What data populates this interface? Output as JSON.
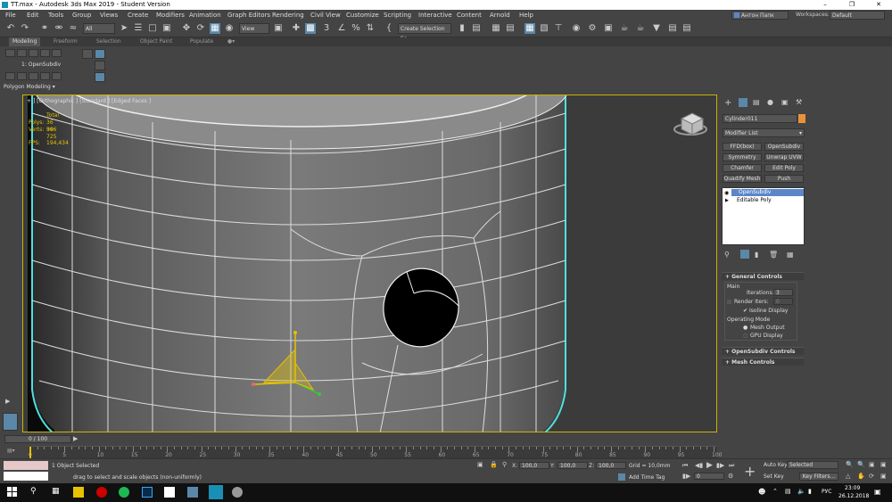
{
  "window": {
    "title": "TT.max - Autodesk 3ds Max 2019 - Student Version"
  },
  "menu": [
    "File",
    "Edit",
    "Tools",
    "Group",
    "Views",
    "Create",
    "Modifiers",
    "Animation",
    "Graph Editors",
    "Rendering",
    "Civil View",
    "Customize",
    "Scripting",
    "Interactive",
    "Content",
    "Arnold",
    "Help"
  ],
  "user": {
    "name": "Антон Папк",
    "workspaces_label": "Workspaces:",
    "workspace_value": "Default"
  },
  "toolbar": {
    "filter_value": "All",
    "refcoord_value": "View",
    "selection_set_value": "Create Selection Se"
  },
  "ribbon": {
    "tabs": [
      "Modeling",
      "Freeform",
      "Selection",
      "Object Paint",
      "Populate"
    ],
    "active_tab": "Modeling",
    "modifier_label": "1: OpenSubdiv",
    "panel_label": "Polygon Modeling"
  },
  "viewport": {
    "label": "+ ] [Orthographic ] [Standard ] [Edged Faces ]",
    "stats": {
      "total_label": "Total",
      "polys_label": "Polys:",
      "polys_value": "36 996",
      "verts_label": "Verts:",
      "verts_value": "36 725",
      "fps_label": "FPS:",
      "fps_value": "194,434"
    }
  },
  "command_panel": {
    "object_name": "Cylinder011",
    "modifier_list": "Modifier List",
    "modifier_buttons": [
      "FFD(box)",
      "OpenSubdiv",
      "Symmetry",
      "Unwrap UVW",
      "Chamfer",
      "Edit Poly",
      "Quadify Mesh",
      "Push"
    ],
    "stack": [
      "OpenSubdiv",
      "Editable Poly"
    ],
    "rollouts": {
      "general": "General Controls",
      "main": "Main",
      "iterations_label": "Iterations:",
      "iterations_value": "3",
      "render_iters_label": "Render Iters:",
      "render_iters_value": "0",
      "isoline": "Isoline Display",
      "op_mode": "Operating Mode",
      "mesh_output": "Mesh Output",
      "gpu_display": "GPU Display",
      "opensubdiv_controls": "OpenSubdiv Controls",
      "mesh_controls": "Mesh Controls"
    }
  },
  "timeline": {
    "slider": "0 / 100",
    "ticks": [
      "0",
      "5",
      "10",
      "15",
      "20",
      "25",
      "30",
      "35",
      "40",
      "45",
      "50",
      "55",
      "60",
      "65",
      "70",
      "75",
      "80",
      "85",
      "90",
      "95",
      "100"
    ]
  },
  "status": {
    "selected": "1 Object Selected",
    "prompt": "drag to select and scale objects (non-uniformly)",
    "x_label": "X:",
    "x_value": "100,0",
    "y_label": "Y:",
    "y_value": "100,0",
    "z_label": "Z:",
    "z_value": "100,0",
    "grid": "Grid = 10,0mm",
    "add_time_tag": "Add Time Tag",
    "auto_key": "Auto Key",
    "set_key": "Set Key",
    "selected_value": "Selected",
    "key_filters": "Key Filters...",
    "frame_value": "0"
  },
  "taskbar": {
    "lang": "РУС",
    "time": "23:09",
    "date": "26.12.2018"
  }
}
